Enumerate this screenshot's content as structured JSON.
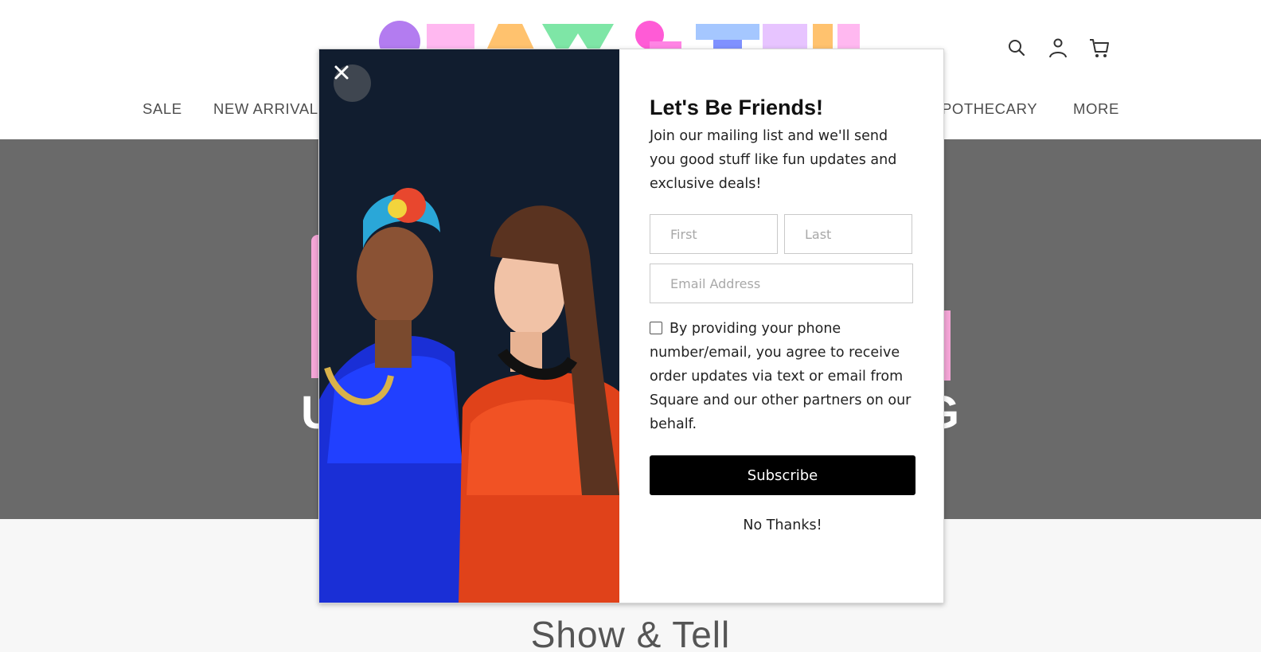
{
  "header": {
    "logo_text": "SHOW & TELL",
    "icons": [
      "search-icon",
      "account-icon",
      "cart-icon"
    ]
  },
  "nav": {
    "items": [
      {
        "label": "SALE"
      },
      {
        "label": "NEW ARRIVALS"
      },
      {
        "label": "APOTHECARY"
      },
      {
        "label": "MORE"
      }
    ]
  },
  "hero": {
    "text_left": "U",
    "text_right": "G"
  },
  "page": {
    "section_title": "Show & Tell"
  },
  "modal": {
    "close_icon": "close-icon",
    "heading": "Let's Be Friends!",
    "description": "Join our mailing list and we'll send you good stuff like fun updates and exclusive deals!",
    "first_placeholder": "First",
    "last_placeholder": "Last",
    "email_placeholder": "Email Address",
    "consent_text": "By providing your phone number/email, you agree to receive order updates via text or email from Square and our other partners on our behalf.",
    "consent_checked": false,
    "subscribe_label": "Subscribe",
    "dismiss_label": "No Thanks!"
  },
  "colors": {
    "modal_button": "#000000",
    "hero_background": "#6a6a6a",
    "hero_accent": "#f4a6d7"
  }
}
